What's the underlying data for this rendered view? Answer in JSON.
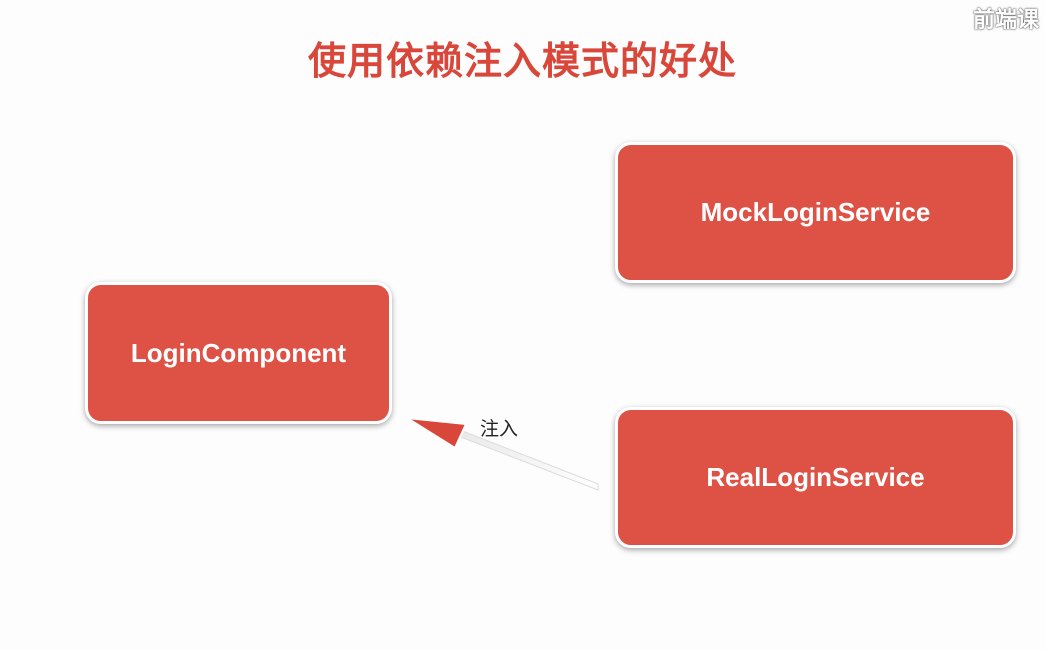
{
  "slide": {
    "title": "使用依赖注入模式的好处",
    "watermark": "前端课"
  },
  "boxes": {
    "mock": "MockLoginService",
    "component": "LoginComponent",
    "real": "RealLoginService"
  },
  "arrow": {
    "label": "注入"
  },
  "colors": {
    "title": "#d9473b",
    "box": "#de5145",
    "arrow": "#d9473b"
  }
}
